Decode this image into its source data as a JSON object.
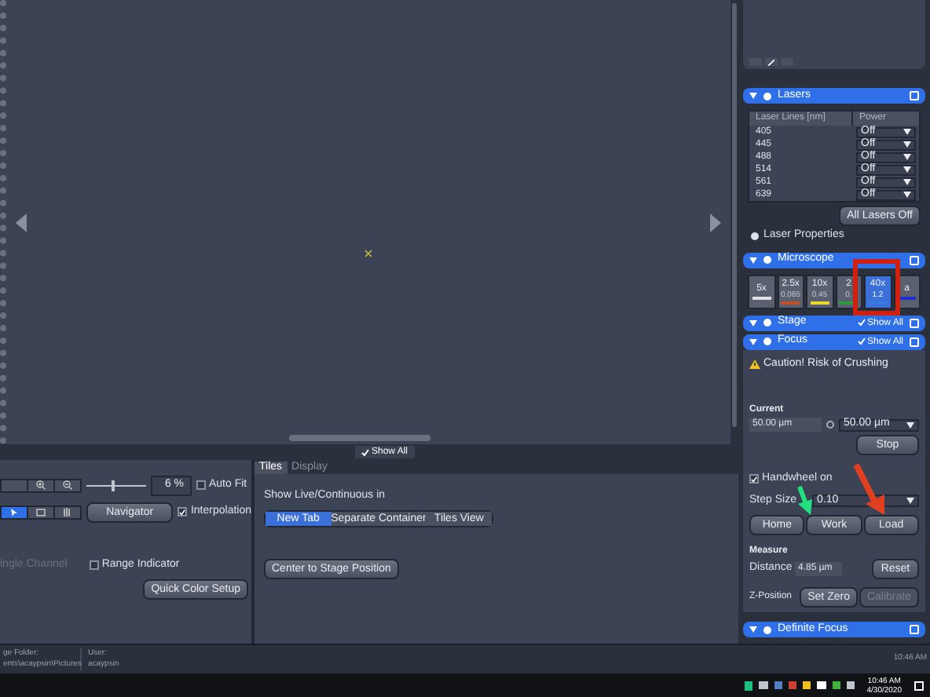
{
  "viewer": {
    "show_all": "Show All"
  },
  "view_panel": {
    "zoom_slider": {
      "level": 0.45
    },
    "zoom": "6 %",
    "auto_fit": {
      "label": "Auto Fit",
      "checked": false
    },
    "navigator": "Navigator",
    "interpolation": {
      "label": "Interpolation",
      "checked": true
    },
    "single_channel": {
      "label": "ingle Channel",
      "disabled": true
    },
    "range_indicator": {
      "label": "Range Indicator",
      "checked": false
    },
    "quick_color": "Quick Color Setup"
  },
  "tiles_panel": {
    "tabs": [
      {
        "label": "Tiles",
        "selected": true
      },
      {
        "label": "Display",
        "selected": false
      }
    ],
    "show_live_label": "Show Live/Continuous in",
    "options": [
      {
        "label": "New Tab",
        "selected": true
      },
      {
        "label": "Separate Container",
        "selected": false
      },
      {
        "label": "Tiles View",
        "selected": false
      }
    ],
    "center_button": "Center to Stage Position"
  },
  "lasers": {
    "title": "Lasers",
    "columns": [
      "Laser Lines [nm]",
      "Power"
    ],
    "rows": [
      {
        "line": "405",
        "power": "Off"
      },
      {
        "line": "445",
        "power": "Off"
      },
      {
        "line": "488",
        "power": "Off"
      },
      {
        "line": "514",
        "power": "Off"
      },
      {
        "line": "561",
        "power": "Off"
      },
      {
        "line": "639",
        "power": "Off"
      }
    ],
    "all_off": "All Lasers Off",
    "properties": "Laser Properties"
  },
  "microscope": {
    "title": "Microscope",
    "objectives": [
      {
        "label": "5x",
        "color": "#e0e0e0",
        "selected": false
      },
      {
        "label": "2.5x",
        "na": "0.085",
        "color": "#c0502a",
        "selected": false
      },
      {
        "label": "10x",
        "na": "0.45",
        "color": "#e8d82a",
        "selected": false
      },
      {
        "label": "2",
        "na": "0.",
        "color": "#2a9a3a",
        "selected": false
      },
      {
        "label": "40x",
        "na": "1.2",
        "color": "#3a7ae0",
        "selected": true
      },
      {
        "label": "a",
        "color": "#2030d0",
        "selected": false
      }
    ]
  },
  "stage": {
    "title": "Stage",
    "show_all": "Show All"
  },
  "focus": {
    "title": "Focus",
    "show_all": "Show All",
    "caution": "Caution! Risk of Crushing",
    "current_label": "Current",
    "current": "50.00 µm",
    "target": "50.00 µm",
    "stop": "Stop",
    "handwheel": {
      "label": "Handwheel on",
      "checked": true
    },
    "step_label": "Step Size",
    "step": "0.10",
    "buttons": [
      "Home",
      "Work",
      "Load"
    ],
    "measure_label": "Measure",
    "distance_label": "Distance",
    "distance": "4.85 µm",
    "reset": "Reset",
    "zpos_label": "Z-Position",
    "set_zero": "Set Zero",
    "calibrate": {
      "label": "Calibrate",
      "disabled": true
    }
  },
  "definite_focus": {
    "title": "Definite Focus"
  },
  "status_bar": {
    "folder_label": "ge Folder:",
    "folder": "ents\\acaypsin\\Pictures",
    "user_label": "User:",
    "user": "acaypsin",
    "time": "10:46 AM"
  },
  "taskbar": {
    "time": "10:46 AM",
    "date": "4/30/2020"
  }
}
